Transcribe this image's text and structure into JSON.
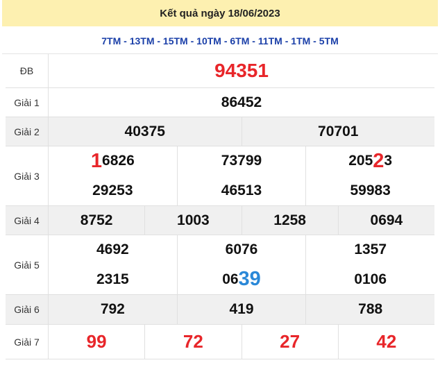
{
  "title": "Kết quả ngày 18/06/2023",
  "codes": "7TM - 13TM - 15TM - 10TM - 6TM - 11TM - 1TM - 5TM",
  "labels": {
    "db": "ĐB",
    "g1": "Giải 1",
    "g2": "Giải 2",
    "g3": "Giải 3",
    "g4": "Giải 4",
    "g5": "Giải 5",
    "g6": "Giải 6",
    "g7": "Giải 7"
  },
  "db": "94351",
  "g1": "86452",
  "g2": [
    "40375",
    "70701"
  ],
  "g3": {
    "r1c1_highlight": "1",
    "r1c1_rest": "6826",
    "r1c2": "73799",
    "r1c3_pre": "205",
    "r1c3_highlight": "2",
    "r1c3_post": "3",
    "r2": [
      "29253",
      "46513",
      "59983"
    ]
  },
  "g4": [
    "8752",
    "1003",
    "1258",
    "0694"
  ],
  "g5": {
    "r1": [
      "4692",
      "6076",
      "1357"
    ],
    "r2c1": "2315",
    "r2c2_pre": "06",
    "r2c2_highlight": "39",
    "r2c3": "0106"
  },
  "g6": [
    "792",
    "419",
    "788"
  ],
  "g7": [
    "99",
    "72",
    "27",
    "42"
  ],
  "colors": {
    "title_bg": "#fdf0b0",
    "codes": "#1a3fa8",
    "red": "#e8262a",
    "blue": "#2a88d8"
  }
}
